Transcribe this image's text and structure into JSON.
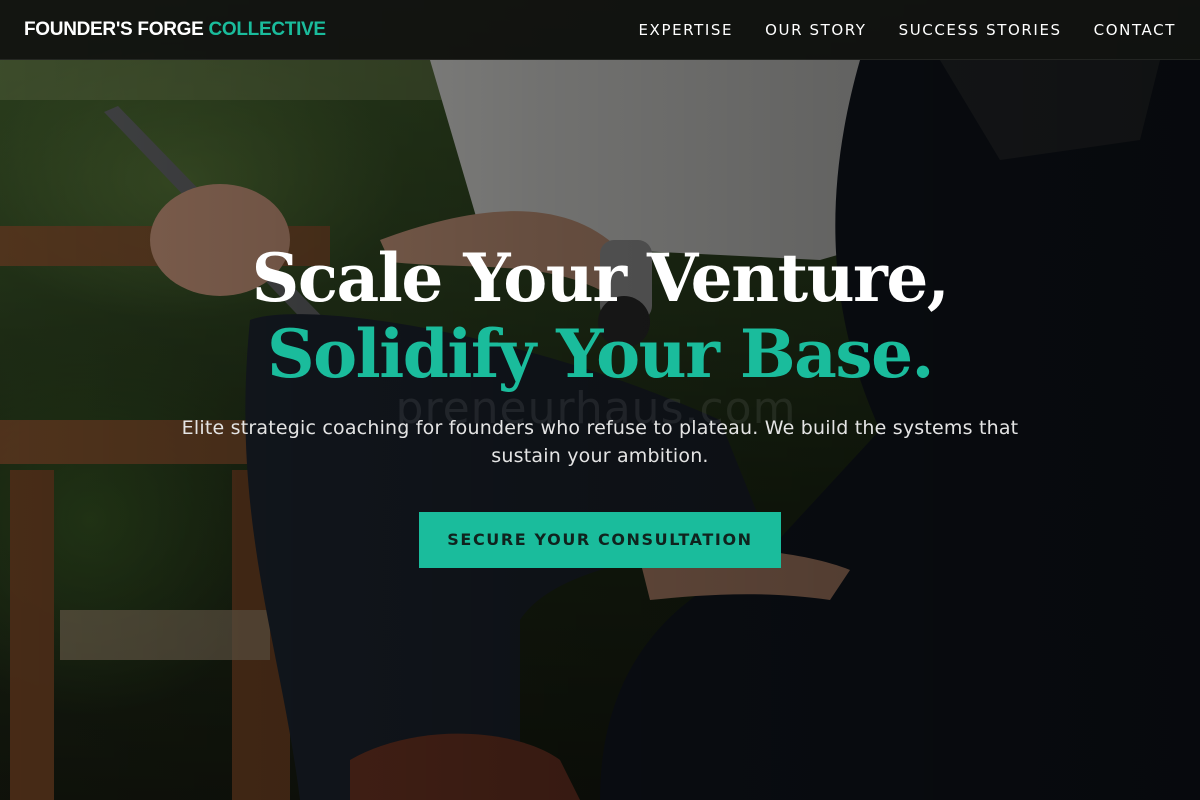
{
  "brand": {
    "name_main": "FOUNDER'S FORGE",
    "name_accent": "COLLECTIVE",
    "accent_color": "#1abc9c"
  },
  "nav": {
    "items": [
      {
        "label": "EXPERTISE"
      },
      {
        "label": "OUR STORY"
      },
      {
        "label": "SUCCESS STORIES"
      },
      {
        "label": "CONTACT"
      }
    ]
  },
  "hero": {
    "headline_line1": "Scale Your Venture,",
    "headline_line2": "Solidify Your Base.",
    "subtitle": "Elite strategic coaching for founders who refuse to plateau. We build the systems that sustain your ambition.",
    "cta_label": "SECURE YOUR CONSULTATION",
    "background_image": "photo of two businesspeople in suits seated outdoors, one holding a tablet",
    "watermark_text": "preneurhaus.com"
  },
  "colors": {
    "accent": "#1abc9c",
    "navbar_bg": "#101010",
    "text": "#ffffff"
  }
}
